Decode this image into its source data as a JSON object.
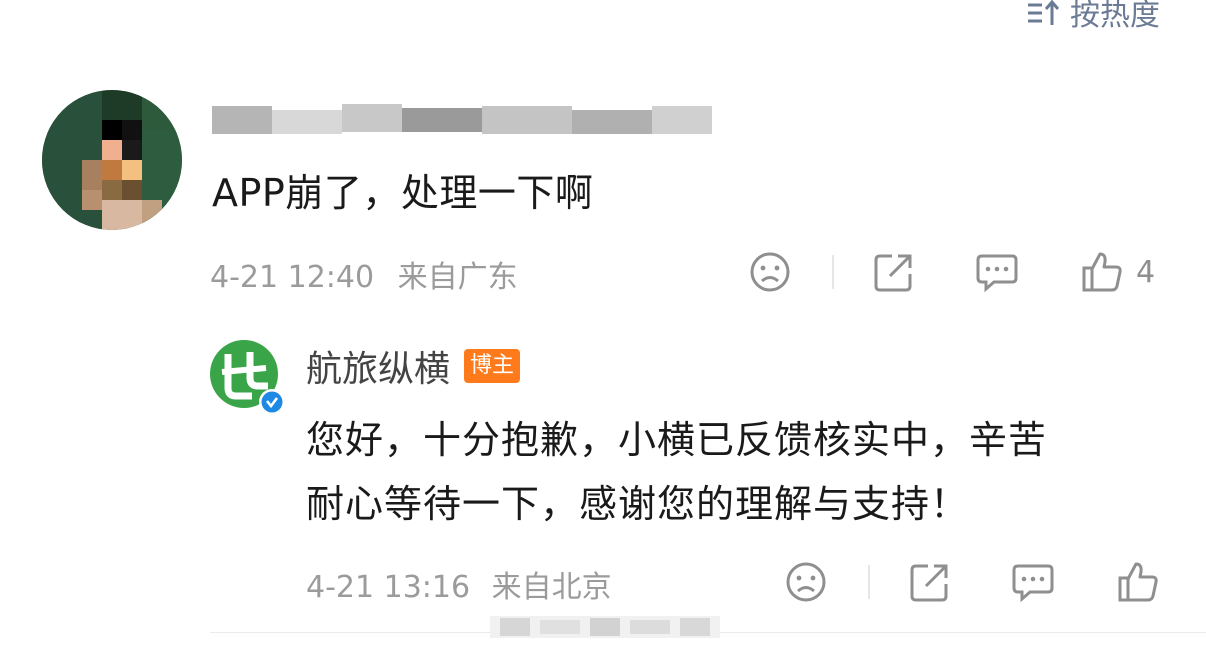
{
  "sort": {
    "label": "按热度"
  },
  "comment": {
    "text": "APP崩了，处理一下啊",
    "timestamp": "4-21 12:40",
    "location": "来自广东",
    "like_count": "4"
  },
  "reply": {
    "username": "航旅纵横",
    "badge": "博主",
    "text_line1": "您好，十分抱歉，小横已反馈核实中，辛苦",
    "text_line2": "耐心等待一下，感谢您的理解与支持！",
    "timestamp": "4-21 13:16",
    "location": "来自北京"
  },
  "colors": {
    "badge": "#ff7a1a",
    "brand_green": "#3aa548",
    "meta_gray": "#9b9b9b",
    "verified_blue": "#1e88e5"
  },
  "icons": [
    "sort-icon",
    "dislike-face-icon",
    "share-icon",
    "comment-icon",
    "thumbs-up-icon",
    "verified-icon"
  ]
}
